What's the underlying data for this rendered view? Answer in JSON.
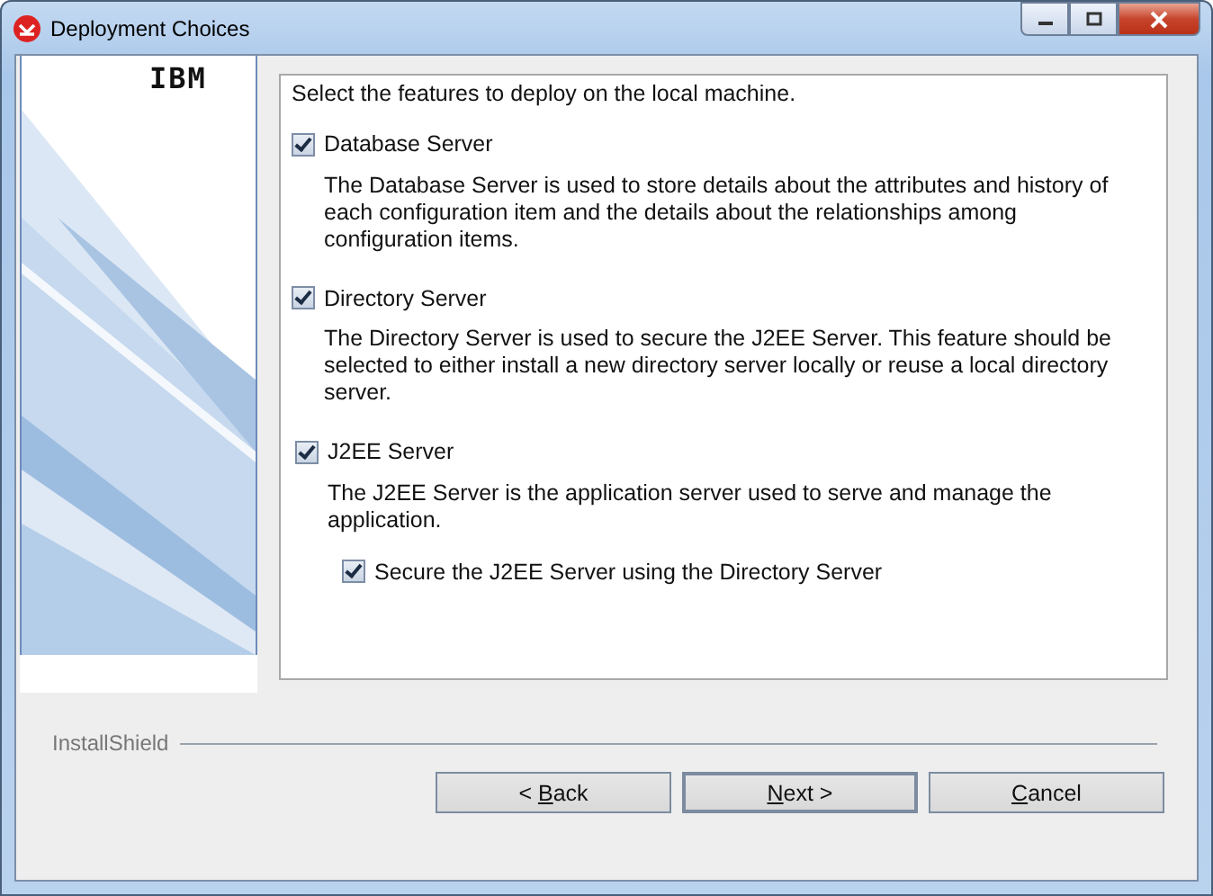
{
  "window": {
    "title": "Deployment Choices"
  },
  "logo": "IBM",
  "intro": "Select the features to deploy on the local machine.",
  "features": [
    {
      "label": "Database Server",
      "checked": true,
      "description": "The Database Server is used to store details about the attributes and history of each configuration item and the details about the relationships among configuration items."
    },
    {
      "label": "Directory Server",
      "checked": true,
      "description": "The Directory Server is used to secure the J2EE Server. This feature should be selected to either install a new directory server locally or reuse a local directory server."
    },
    {
      "label": "J2EE Server",
      "checked": true,
      "description": "The J2EE Server is the application server used to serve and manage the application.",
      "children": [
        {
          "label": "Secure the J2EE Server using the Directory Server",
          "checked": true
        }
      ]
    }
  ],
  "brand": "InstallShield",
  "buttons": [
    {
      "before": "< ",
      "mnemonic": "B",
      "after": "ack",
      "default": false
    },
    {
      "mnemonic": "N",
      "after": "ext >",
      "default": true
    },
    {
      "mnemonic": "C",
      "after": "ancel",
      "default": false
    }
  ]
}
